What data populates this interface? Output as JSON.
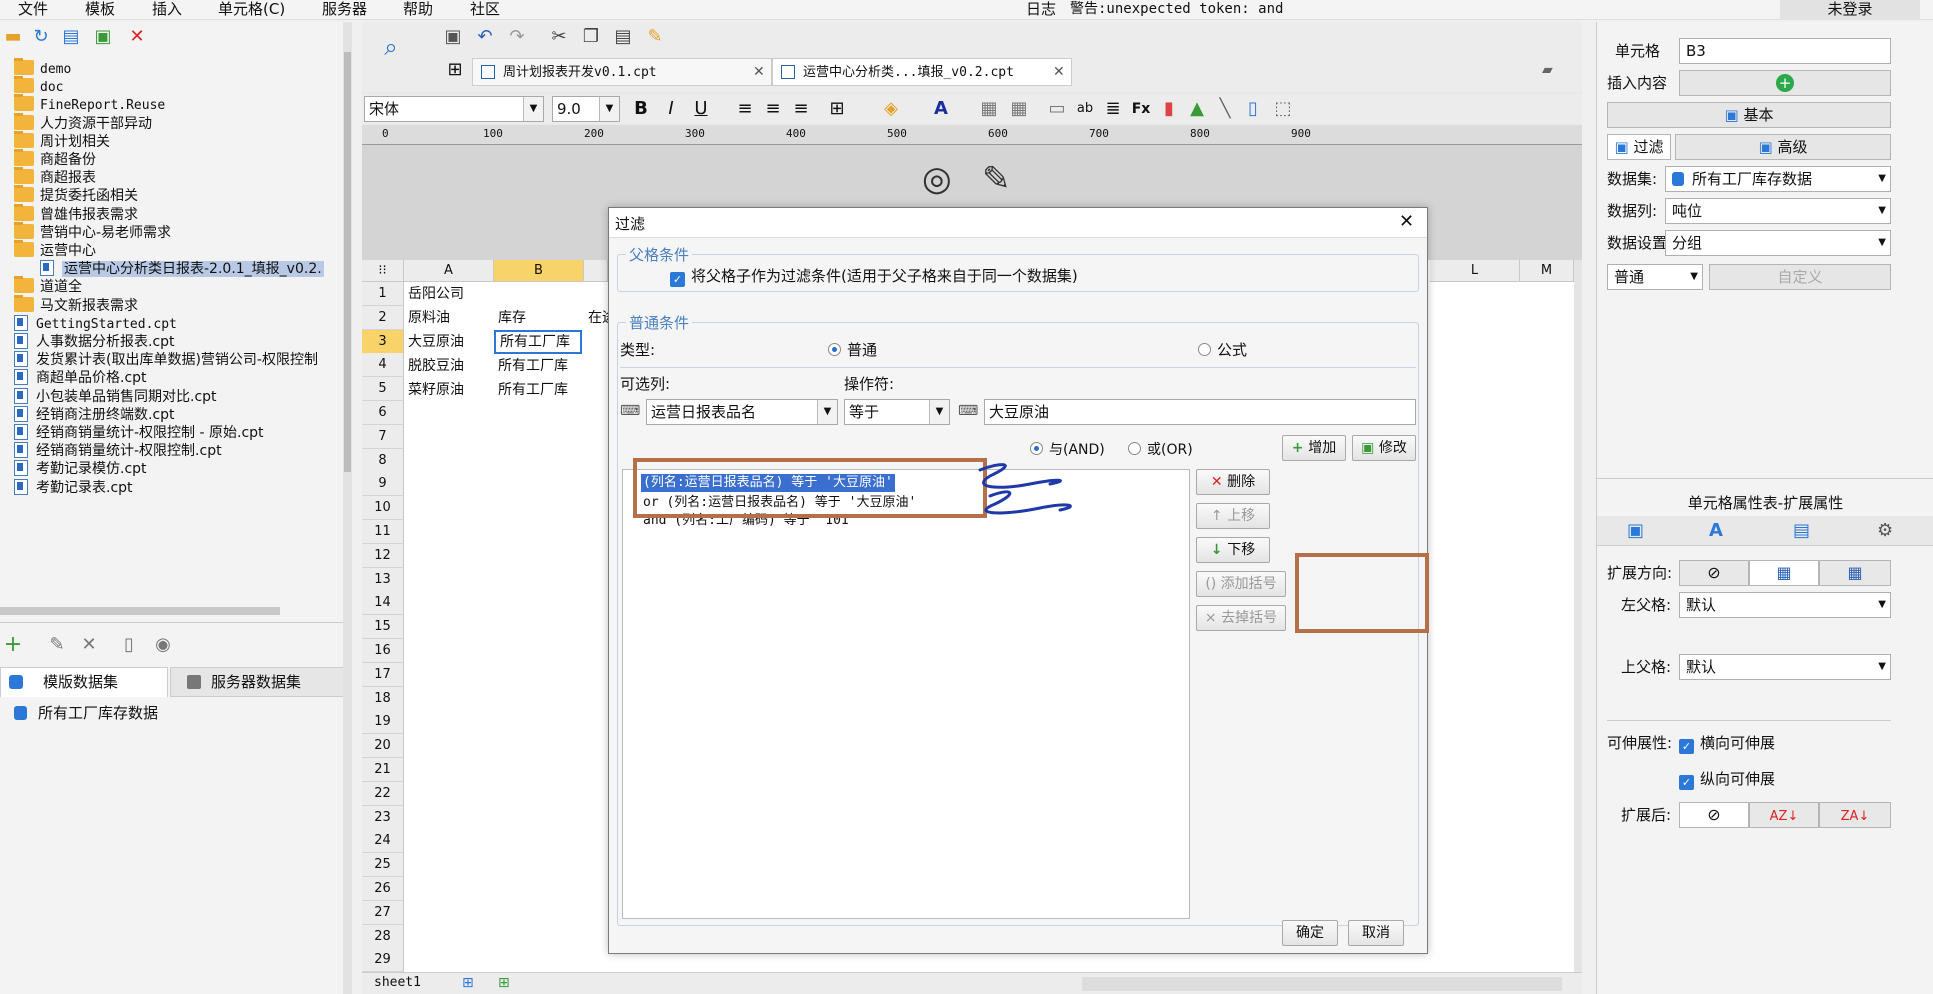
{
  "menubar": {
    "items": [
      "文件",
      "模板",
      "插入",
      "单元格(C)",
      "服务器",
      "帮助",
      "社区"
    ],
    "log_label": "日志",
    "warning": "警告:unexpected token: and",
    "login": "未登录"
  },
  "tree": {
    "items": [
      {
        "label": "demo",
        "type": "folder",
        "mono": true
      },
      {
        "label": "doc",
        "type": "folder",
        "mono": true
      },
      {
        "label": "FineReport.Reuse",
        "type": "folder",
        "mono": true
      },
      {
        "label": "人力资源干部异动",
        "type": "folder"
      },
      {
        "label": "周计划相关",
        "type": "folder"
      },
      {
        "label": "商超备份",
        "type": "folder"
      },
      {
        "label": "商超报表",
        "type": "folder"
      },
      {
        "label": "提货委托函相关",
        "type": "folder"
      },
      {
        "label": "曾雄伟报表需求",
        "type": "folder"
      },
      {
        "label": "营销中心-易老师需求",
        "type": "folder"
      },
      {
        "label": "运营中心",
        "type": "folder"
      },
      {
        "label": "运营中心分析类日报表-2.0.1_填报_v0.2.",
        "type": "file",
        "indent": true,
        "selected": true
      },
      {
        "label": "道道全",
        "type": "folder"
      },
      {
        "label": "马文新报表需求",
        "type": "folder"
      },
      {
        "label": "GettingStarted.cpt",
        "type": "file",
        "mono": true
      },
      {
        "label": "人事数据分析报表.cpt",
        "type": "file"
      },
      {
        "label": "发货累计表(取出库单数据)营销公司-权限控制",
        "type": "file"
      },
      {
        "label": "商超单品价格.cpt",
        "type": "file"
      },
      {
        "label": "小包装单品销售同期对比.cpt",
        "type": "file"
      },
      {
        "label": "经销商注册终端数.cpt",
        "type": "file"
      },
      {
        "label": "经销商销量统计-权限控制 - 原始.cpt",
        "type": "file"
      },
      {
        "label": "经销商销量统计-权限控制.cpt",
        "type": "file"
      },
      {
        "label": "考勤记录模仿.cpt",
        "type": "file"
      },
      {
        "label": "考勤记录表.cpt",
        "type": "file"
      }
    ]
  },
  "datasets": {
    "tab_template": "模版数据集",
    "tab_server": "服务器数据集",
    "item": "所有工厂库存数据"
  },
  "tabs": {
    "tab1": "周计划报表开发v0.1.cpt",
    "tab2": "运营中心分析类...填报_v0.2.cpt"
  },
  "format": {
    "font": "宋体",
    "size": "9.0"
  },
  "ruler": {
    "ticks": [
      "0",
      "100",
      "200",
      "300",
      "400",
      "500",
      "600",
      "700",
      "800",
      "900"
    ]
  },
  "sheet": {
    "columns": [
      "A",
      "B",
      "L",
      "M"
    ],
    "rows": [
      "1",
      "2",
      "3",
      "4",
      "5",
      "6",
      "7",
      "8",
      "9",
      "10",
      "11",
      "12",
      "13",
      "14",
      "15",
      "16",
      "17",
      "18",
      "19",
      "20",
      "21",
      "22",
      "23",
      "24",
      "25",
      "26",
      "27",
      "28",
      "29"
    ],
    "cells": {
      "a1": "岳阳公司",
      "a2": "原料油",
      "b2": "库存",
      "c2": "在途",
      "a3": "大豆原油",
      "b3": "所有工厂库",
      "a4": "脱胶豆油",
      "b4": "所有工厂库",
      "a5": "菜籽原油",
      "b5": "所有工厂库"
    },
    "sheet_tab": "sheet1"
  },
  "dialog": {
    "title": "过滤",
    "parent_legend": "父格条件",
    "parent_check": "将父格子作为过滤条件(适用于父子格来自于同一个数据集)",
    "normal_legend": "普通条件",
    "type_label": "类型:",
    "type_normal": "普通",
    "type_formula": "公式",
    "column_label": "可选列:",
    "op_label": "操作符:",
    "column_value": "运营日报表品名",
    "op_value": "等于",
    "value_input": "大豆原油",
    "and_label": "与(AND)",
    "or_label": "或(OR)",
    "add_btn": "增加",
    "modify_btn": "修改",
    "conditions": [
      "(列名:运营日报表品名) 等于 '大豆原油'",
      "or  (列名:运营日报表品名) 等于 '大豆原油'",
      "and (列名:工厂编码) 等于 '101'"
    ],
    "delete_btn": "删除",
    "up_btn": "上移",
    "down_btn": "下移",
    "add_paren_btn": "添加括号",
    "remove_paren_btn": "去掉括号",
    "ok_btn": "确定",
    "cancel_btn": "取消"
  },
  "right": {
    "cell_label": "单元格",
    "cell_value": "B3",
    "insert_label": "插入内容",
    "basic_btn": "基本",
    "filter_btn": "过滤",
    "advanced_btn": "高级",
    "dataset_label": "数据集:",
    "dataset_value": "所有工厂库存数据",
    "column_label": "数据列:",
    "column_value": "吨位",
    "setting_label": "数据设置:",
    "setting_value": "分组",
    "mode_value": "普通",
    "custom_btn": "自定义",
    "attr_title": "单元格属性表-扩展属性",
    "expand_dir_label": "扩展方向:",
    "left_parent_label": "左父格:",
    "left_parent_value": "默认",
    "top_parent_label": "上父格:",
    "top_parent_value": "默认",
    "stretch_label": "可伸展性:",
    "horiz_label": "横向可伸展",
    "vert_label": "纵向可伸展",
    "after_label": "扩展后:"
  },
  "colors": {
    "accent": "#2b78d8",
    "annotation_box": "#b5704a",
    "ink": "#1f3aa8",
    "selected": "#3a6fcf"
  }
}
